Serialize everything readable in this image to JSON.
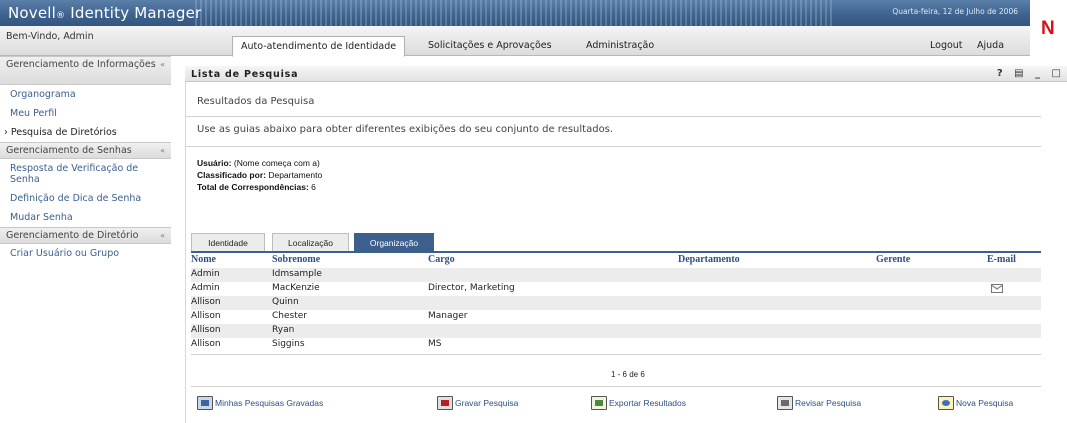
{
  "header": {
    "brand": "Novell",
    "brand_mark": "®",
    "product": "Identity Manager",
    "date": "Quarta-feira, 12 de Julho de 2006",
    "logo_letter": "N",
    "welcome": "Bem-Vindo, Admin"
  },
  "nav": {
    "tabs": [
      {
        "label": "Auto-atendimento de Identidade",
        "active": true
      },
      {
        "label": "Solicitações e Aprovações",
        "active": false
      },
      {
        "label": "Administração",
        "active": false
      }
    ],
    "logout": "Logout",
    "help": "Ajuda"
  },
  "sidebar": {
    "sections": [
      {
        "title": "Gerenciamento de Informações",
        "items": [
          {
            "label": "Organograma"
          },
          {
            "label": "Meu Perfil"
          },
          {
            "label": "Pesquisa de Diretórios",
            "current": true
          }
        ]
      },
      {
        "title": "Gerenciamento de Senhas",
        "items": [
          {
            "label": "Resposta de Verificação de Senha"
          },
          {
            "label": "Definição de Dica de Senha"
          },
          {
            "label": "Mudar Senha"
          }
        ]
      },
      {
        "title": "Gerenciamento de Diretório",
        "items": [
          {
            "label": "Criar Usuário ou Grupo"
          }
        ]
      }
    ],
    "collapse_glyph": "«"
  },
  "portlet": {
    "title": "Lista de Pesquisa",
    "controls": "? ▤ _ □",
    "subtitle": "Resultados da Pesquisa",
    "instructions": "Use as guias abaixo para obter diferentes exibições do seu conjunto de resultados.",
    "criteria": {
      "user_label": "Usuário:",
      "user_value": "(Nome começa com a)",
      "sorted_label": "Classificado por:",
      "sorted_value": "Departamento",
      "total_label": "Total de Correspondências:",
      "total_value": "6"
    },
    "tabs": [
      {
        "label": "Identidade",
        "active": false
      },
      {
        "label": "Localização",
        "active": false
      },
      {
        "label": "Organização",
        "active": true
      }
    ],
    "table": {
      "columns": [
        "Nome",
        "Sobrenome",
        "Cargo",
        "Departamento",
        "Gerente",
        "E-mail"
      ],
      "rows": [
        {
          "nome": "Admin",
          "sobrenome": "Idmsample",
          "cargo": "",
          "departamento": "",
          "gerente": "",
          "email": false
        },
        {
          "nome": "Admin",
          "sobrenome": "MacKenzie",
          "cargo": "Director, Marketing",
          "departamento": "",
          "gerente": "",
          "email": true
        },
        {
          "nome": "Allison",
          "sobrenome": "Quinn",
          "cargo": "",
          "departamento": "",
          "gerente": "",
          "email": false
        },
        {
          "nome": "Allison",
          "sobrenome": "Chester",
          "cargo": "Manager",
          "departamento": "",
          "gerente": "",
          "email": false
        },
        {
          "nome": "Allison",
          "sobrenome": "Ryan",
          "cargo": "",
          "departamento": "",
          "gerente": "",
          "email": false
        },
        {
          "nome": "Allison",
          "sobrenome": "Siggins",
          "cargo": "MS",
          "departamento": "",
          "gerente": "",
          "email": false
        }
      ]
    },
    "pager": "1 - 6 de 6",
    "actions": [
      {
        "label": "Minhas Pesquisas Gravadas",
        "icon": "saved-searches-icon"
      },
      {
        "label": "Gravar Pesquisa",
        "icon": "save-icon"
      },
      {
        "label": "Exportar Resultados",
        "icon": "export-icon"
      },
      {
        "label": "Revisar Pesquisa",
        "icon": "revise-icon"
      },
      {
        "label": "Nova Pesquisa",
        "icon": "new-search-icon"
      }
    ]
  },
  "colors": {
    "banner": "#3f6490",
    "accent": "#3c5f8e",
    "link": "#3a5f8f",
    "logo": "#d7101a"
  }
}
